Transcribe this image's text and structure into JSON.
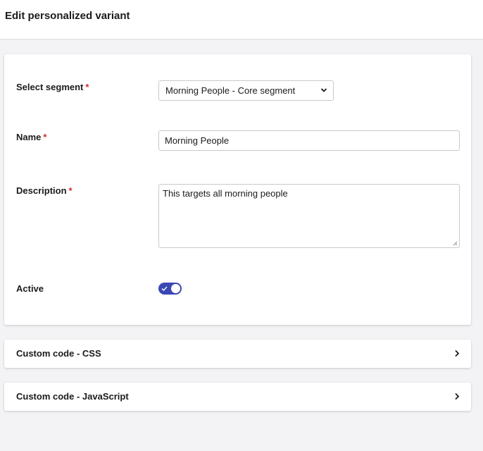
{
  "header": {
    "title": "Edit personalized variant"
  },
  "form": {
    "segment": {
      "label": "Select segment",
      "required_mark": "*",
      "value": "Morning People - Core segment"
    },
    "name": {
      "label": "Name",
      "required_mark": "*",
      "value": "Morning People"
    },
    "description": {
      "label": "Description",
      "required_mark": "*",
      "value": "This targets all morning people"
    },
    "active": {
      "label": "Active",
      "state": "on"
    }
  },
  "accordions": [
    {
      "label": "Custom code - CSS"
    },
    {
      "label": "Custom code - JavaScript"
    }
  ],
  "colors": {
    "accent": "#3a48b3",
    "required": "#d42c2c",
    "background": "#f3f3f5"
  }
}
